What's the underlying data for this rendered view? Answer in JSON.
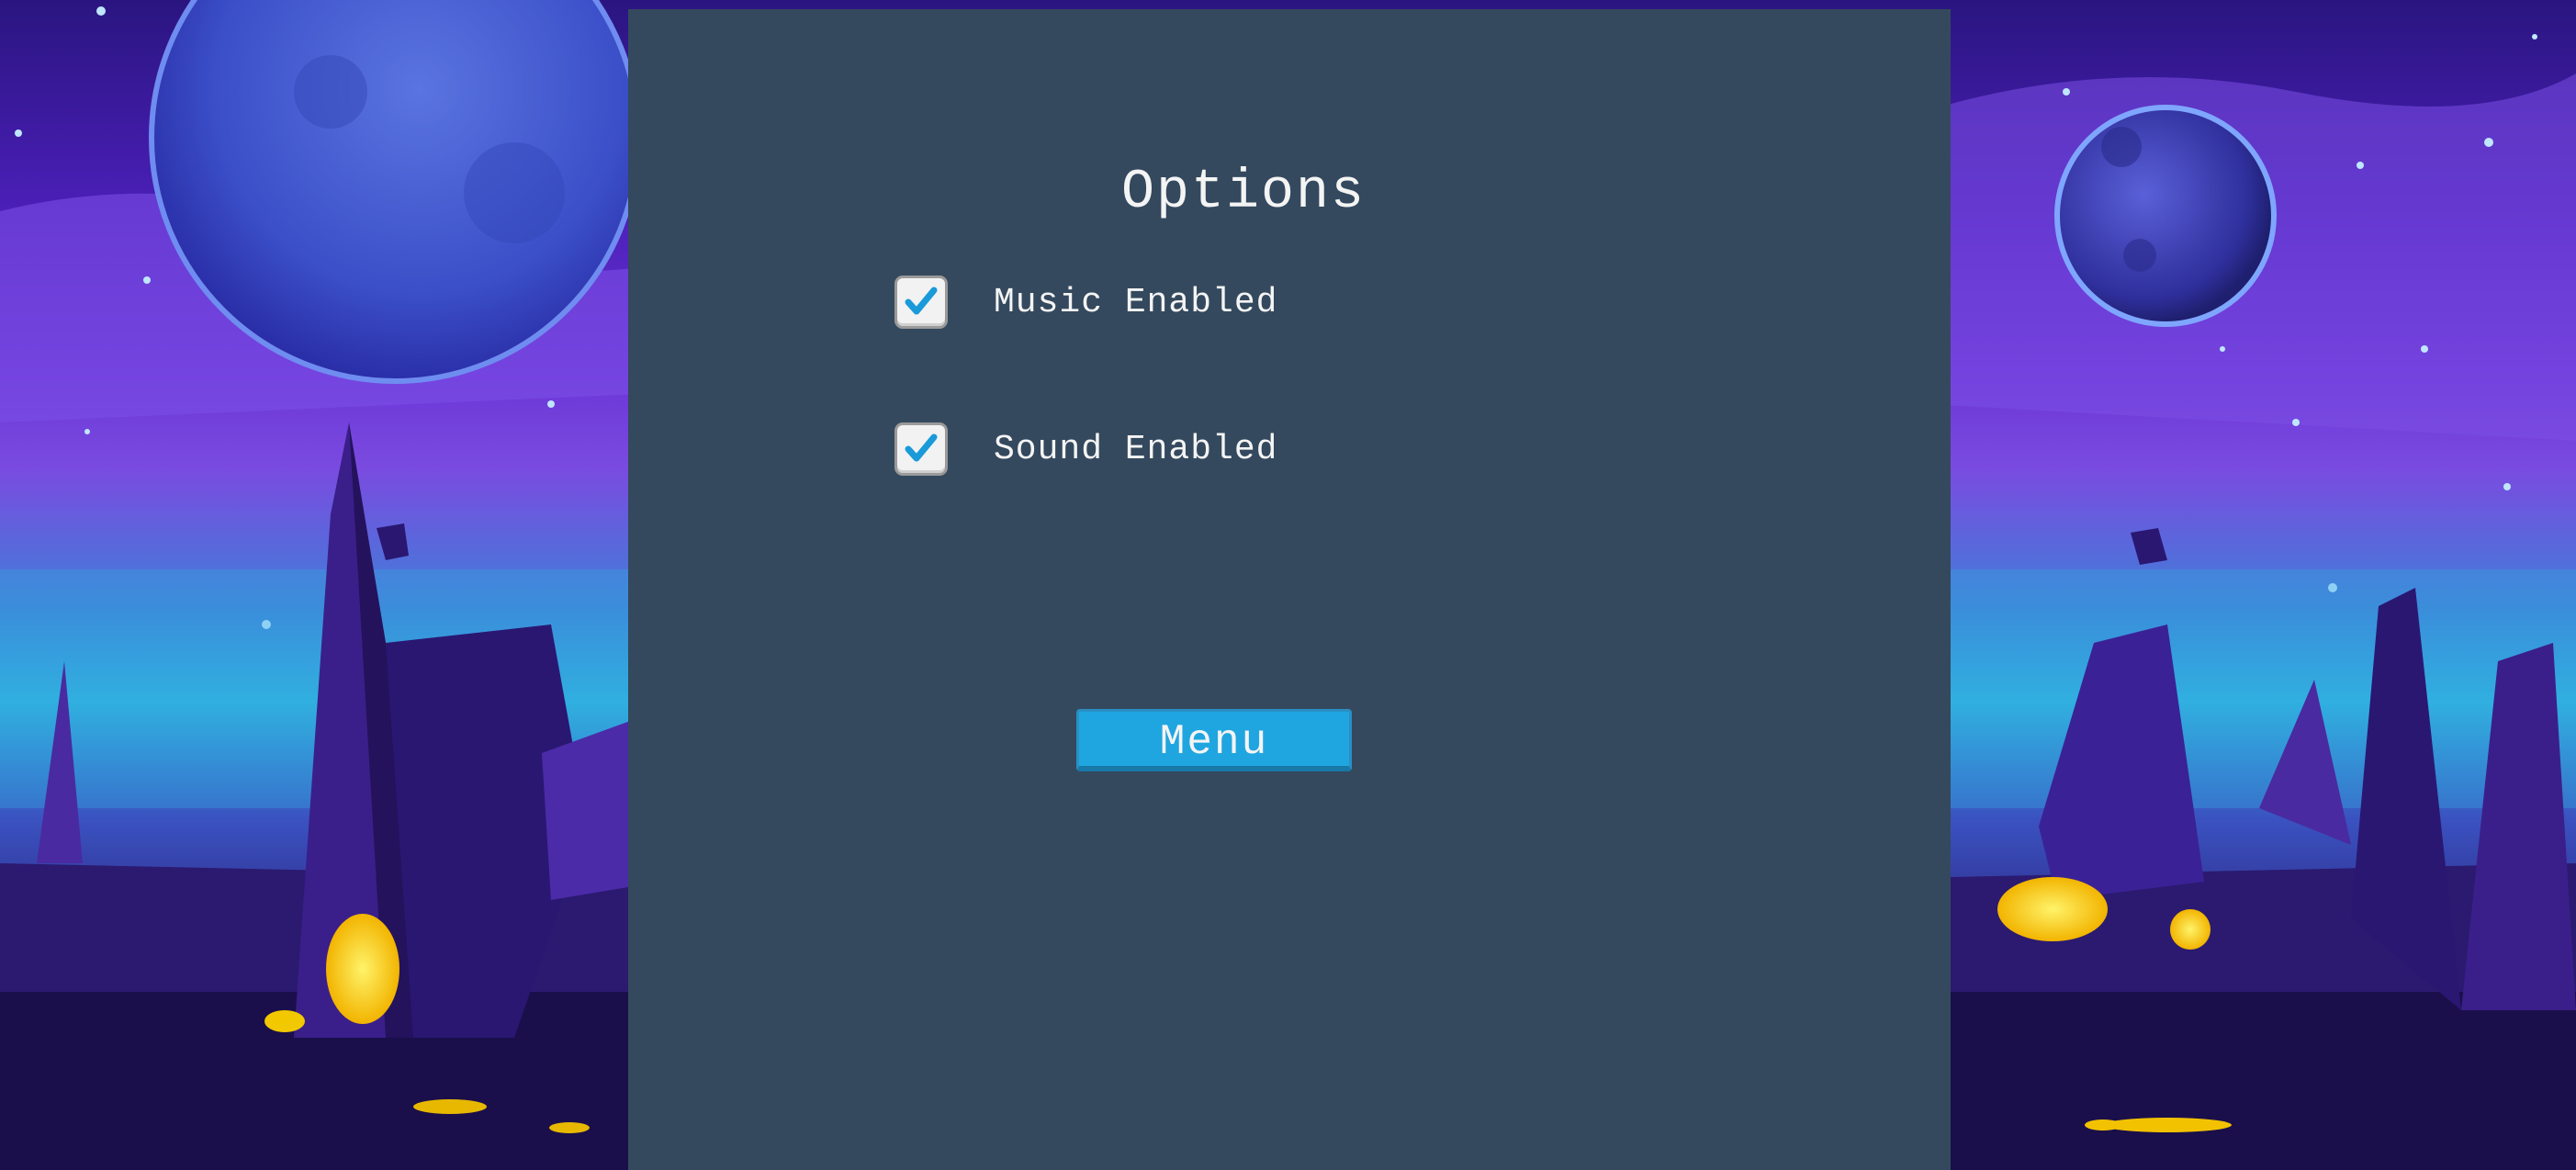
{
  "options_screen": {
    "title": "Options",
    "music": {
      "label": "Music Enabled",
      "checked": true
    },
    "sound": {
      "label": "Sound Enabled",
      "checked": true
    },
    "menu_button": {
      "label": "Menu"
    }
  },
  "colors": {
    "panel": "#34495e",
    "button": "#1fa6e0",
    "checkmark": "#1a9ad8",
    "text": "#f4f4f4"
  },
  "icons": {
    "checkbox_mark": "checkmark-icon"
  }
}
